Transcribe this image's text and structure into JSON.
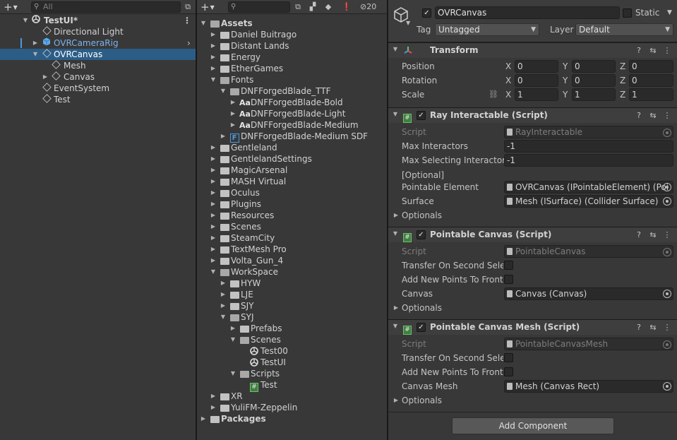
{
  "hierarchy": {
    "search_placeholder": "All",
    "scene_name": "TestUI*",
    "items": [
      {
        "label": "Directional Light"
      },
      {
        "label": "OVRCameraRig"
      },
      {
        "label": "OVRCanvas"
      },
      {
        "label": "Mesh"
      },
      {
        "label": "Canvas"
      },
      {
        "label": "EventSystem"
      },
      {
        "label": "Test"
      }
    ]
  },
  "project": {
    "hidden_count": "20",
    "root": "Assets",
    "items": [
      {
        "label": "Daniel Buitrago"
      },
      {
        "label": "Distant Lands"
      },
      {
        "label": "Energy"
      },
      {
        "label": "EtherGames"
      },
      {
        "label": "Fonts"
      },
      {
        "label": "DNFForgedBlade_TTF"
      },
      {
        "label": "DNFForgedBlade-Bold"
      },
      {
        "label": "DNFForgedBlade-Light"
      },
      {
        "label": "DNFForgedBlade-Medium"
      },
      {
        "label": "DNFForgedBlade-Medium SDF"
      },
      {
        "label": "Gentleland"
      },
      {
        "label": "GentlelandSettings"
      },
      {
        "label": "MagicArsenal"
      },
      {
        "label": "MASH Virtual"
      },
      {
        "label": "Oculus"
      },
      {
        "label": "Plugins"
      },
      {
        "label": "Resources"
      },
      {
        "label": "Scenes"
      },
      {
        "label": "SteamCity"
      },
      {
        "label": "TextMesh Pro"
      },
      {
        "label": "Volta_Gun_4"
      },
      {
        "label": "WorkSpace"
      },
      {
        "label": "HYW"
      },
      {
        "label": "LJE"
      },
      {
        "label": "SJY"
      },
      {
        "label": "SYJ"
      },
      {
        "label": "Prefabs"
      },
      {
        "label": "Scenes"
      },
      {
        "label": "Test00"
      },
      {
        "label": "TestUI"
      },
      {
        "label": "Scripts"
      },
      {
        "label": "Test"
      },
      {
        "label": "XR"
      },
      {
        "label": "YuliFM-Zeppelin"
      }
    ],
    "packages": "Packages",
    "font_glyph": "Aa",
    "sdf_glyph": "F"
  },
  "inspector": {
    "object_name": "OVRCanvas",
    "static_label": "Static",
    "tag_label": "Tag",
    "tag_value": "Untagged",
    "layer_label": "Layer",
    "layer_value": "Default",
    "transform": {
      "title": "Transform",
      "position_label": "Position",
      "rotation_label": "Rotation",
      "scale_label": "Scale",
      "x": "X",
      "y": "Y",
      "z": "Z",
      "position": [
        "0",
        "0",
        "0"
      ],
      "rotation": [
        "0",
        "0",
        "0"
      ],
      "scale": [
        "1",
        "1",
        "1"
      ]
    },
    "ray": {
      "title": "Ray Interactable (Script)",
      "script_label": "Script",
      "script_value": "RayInteractable",
      "max_interactors_label": "Max Interactors",
      "max_interactors": "-1",
      "max_selecting_label": "Max Selecting Interactors",
      "max_selecting": "-1",
      "optional_header": "[Optional]",
      "pointable_element_label": "Pointable Element",
      "pointable_element": "OVRCanvas (IPointableElement) (Poi",
      "surface_label": "Surface",
      "surface": "Mesh (ISurface) (Collider Surface)",
      "optionals": "Optionals"
    },
    "canvas": {
      "title": "Pointable Canvas (Script)",
      "script_label": "Script",
      "script_value": "PointableCanvas",
      "transfer_label": "Transfer On Second Selec",
      "addnew_label": "Add New Points To Front",
      "canvas_label": "Canvas",
      "canvas_value": "Canvas (Canvas)",
      "optionals": "Optionals"
    },
    "mesh": {
      "title": "Pointable Canvas Mesh (Script)",
      "script_label": "Script",
      "script_value": "PointableCanvasMesh",
      "transfer_label": "Transfer On Second Selec",
      "addnew_label": "Add New Points To Front",
      "canvas_mesh_label": "Canvas Mesh",
      "canvas_mesh_value": "Mesh (Canvas Rect)",
      "optionals": "Optionals"
    },
    "add_component": "Add Component"
  }
}
